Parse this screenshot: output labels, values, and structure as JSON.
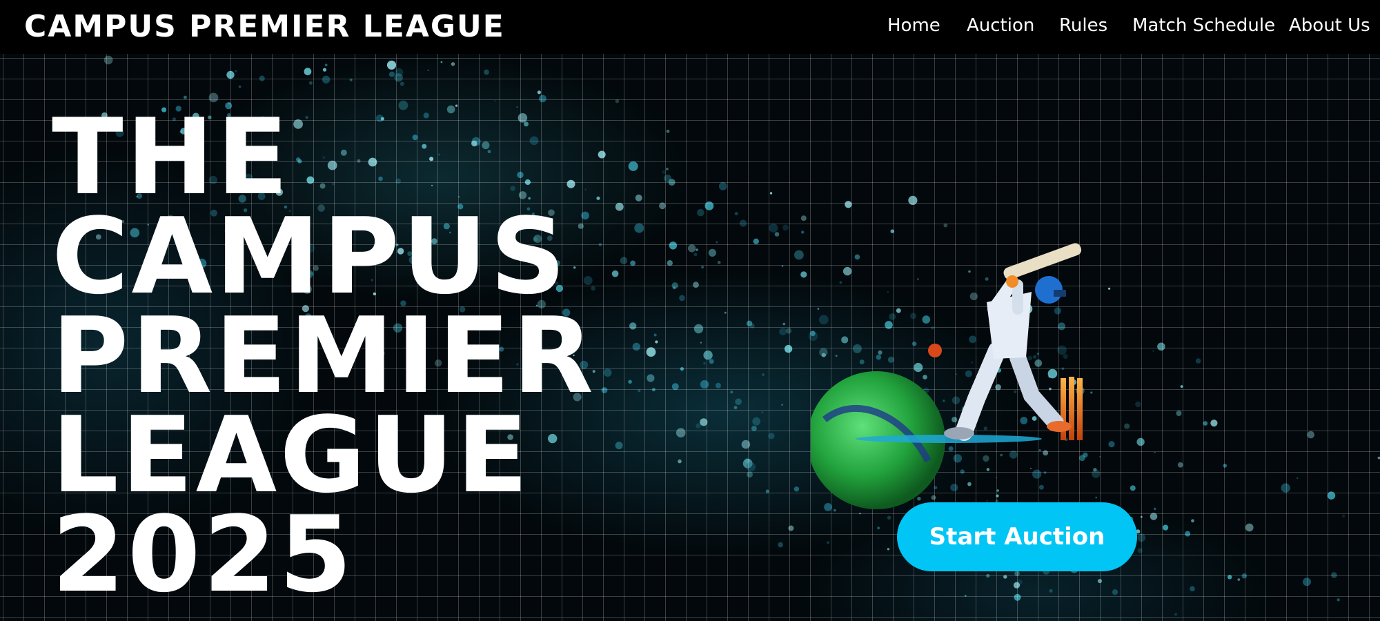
{
  "header": {
    "brand": "CAMPUS PREMIER LEAGUE",
    "nav": [
      {
        "label": "Home"
      },
      {
        "label": "Auction"
      },
      {
        "label": "Rules"
      },
      {
        "label": "Match Schedule"
      },
      {
        "label": "About Us"
      }
    ]
  },
  "hero": {
    "title_lines": [
      "THE",
      "CAMPUS",
      "PREMIER",
      "LEAGUE",
      "2025"
    ],
    "cta_label": "Start Auction",
    "illustration_icon": "cricket-batsman-icon",
    "accent_color": "#00c5f5",
    "background_color": "#000000"
  }
}
